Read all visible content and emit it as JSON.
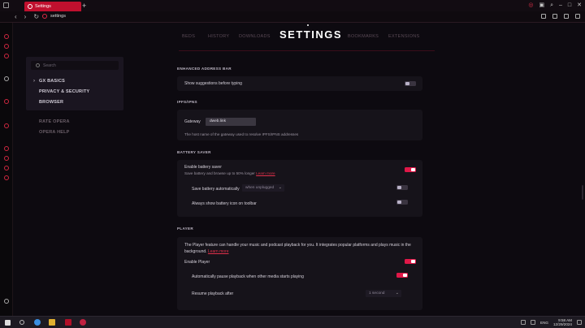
{
  "browser": {
    "tab_title": "Settings",
    "new_tab_symbol": "+",
    "address": "settings"
  },
  "header": {
    "title": "SETTINGS",
    "nav": [
      "BEDS",
      "HISTORY",
      "DOWNLOADS",
      "BOOKMARKS",
      "EXTENSIONS"
    ]
  },
  "menu": {
    "search_placeholder": "Search",
    "items": [
      "GX BASICS",
      "PRIVACY & SECURITY",
      "BROWSER"
    ],
    "secondary": [
      "RATE OPERA",
      "OPERA HELP"
    ]
  },
  "sections": {
    "address_bar": {
      "heading": "ENHANCED ADDRESS BAR",
      "show_suggestions": "Show suggestions before typing",
      "show_suggestions_enabled": false
    },
    "ipfs": {
      "heading": "IPFS/IPNS",
      "gateway_label": "Gateway",
      "gateway_value": "dweb.link",
      "gateway_help": "The host name of the gateway used to resolve IPFS/IPNS addresses"
    },
    "battery": {
      "heading": "BATTERY SAVER",
      "enable_label": "Enable battery saver",
      "enable_sub": "Save battery and browse up to 50% longer",
      "learn_more": "Learn more",
      "enable_on": true,
      "auto_label": "Save battery automatically",
      "auto_option": "when unplugged",
      "auto_on": false,
      "show_icon_label": "Always show battery icon on toolbar",
      "show_icon_on": false
    },
    "player": {
      "heading": "PLAYER",
      "description": "The Player feature can handle your music and podcast playback for you. It integrates popular platforms and plays music in the background.",
      "learn_more": "Learn more",
      "enable_label": "Enable Player",
      "enable_on": true,
      "auto_pause_label": "Automatically pause playback when other media starts playing",
      "auto_pause_on": true,
      "resume_label": "Resume playback after",
      "resume_option": "1 second"
    }
  },
  "taskbar": {
    "lang": "ENG",
    "time": "9:58 AM",
    "date": "12/29/2024"
  },
  "colors": {
    "accent": "#e01848",
    "background": "#0d0a10",
    "card": "#16131a"
  }
}
